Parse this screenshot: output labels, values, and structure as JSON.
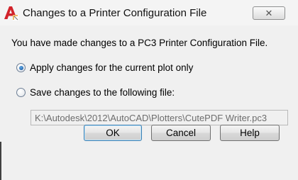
{
  "window": {
    "title": "Changes to a Printer Configuration File",
    "close_label": "✕",
    "logo_icon": "autocad-logo-icon"
  },
  "dialog": {
    "message": "You have made changes to a PC3 Printer Configuration File.",
    "options": [
      {
        "label": "Apply changes for the current plot only",
        "selected": true
      },
      {
        "label": "Save changes to the following file:",
        "selected": false
      }
    ],
    "file_path": "K:\\Autodesk\\2012\\AutoCAD\\Plotters\\CutePDF Writer.pc3"
  },
  "buttons": {
    "ok": "OK",
    "cancel": "Cancel",
    "help": "Help"
  },
  "colors": {
    "accent": "#1a4f92",
    "logo_red": "#d2232a"
  }
}
